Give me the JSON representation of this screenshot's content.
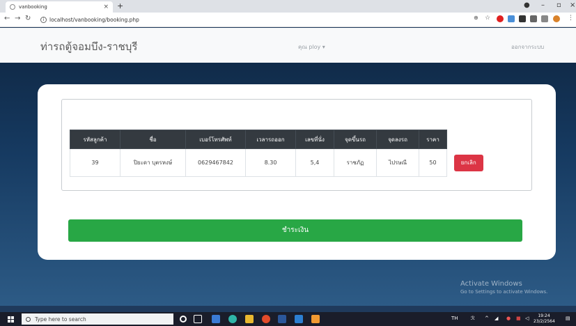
{
  "browser": {
    "tab_title": "vanbooking",
    "tab_close": "×",
    "new_tab": "+",
    "url": "localhost/vanbooking/booking.php"
  },
  "navbar": {
    "brand": "ท่ารถตู้จอมบึง-ราชบุรี",
    "user": "คุณ ploy ▾",
    "logout": "ออกจากระบบ"
  },
  "table": {
    "headers": [
      "รหัสลูกค้า",
      "ชื่อ",
      "เบอร์โทรศัพท์",
      "เวลารถออก",
      "เลขที่นั่ง",
      "จุดขึ้นรถ",
      "จุดลงรถ",
      "ราคา"
    ],
    "rows": [
      {
        "cells": [
          "39",
          "ปิยะดา บุตรหงษ์",
          "0629467842",
          "8.30",
          "5,4",
          "ราชภัฏ",
          "ไปรษณี",
          "50"
        ],
        "action": "ยกเลิก"
      }
    ]
  },
  "pay_button": "ชำระเงิน",
  "watermark": {
    "line1": "Activate Windows",
    "line2": "Go to Settings to activate Windows."
  },
  "taskbar": {
    "search_placeholder": "Type here to search",
    "lang": "TH",
    "time": "19:24",
    "date": "23/2/2564"
  },
  "colors": {
    "pay": "#28a745",
    "cancel": "#dc3545",
    "table_header": "#343a40"
  }
}
